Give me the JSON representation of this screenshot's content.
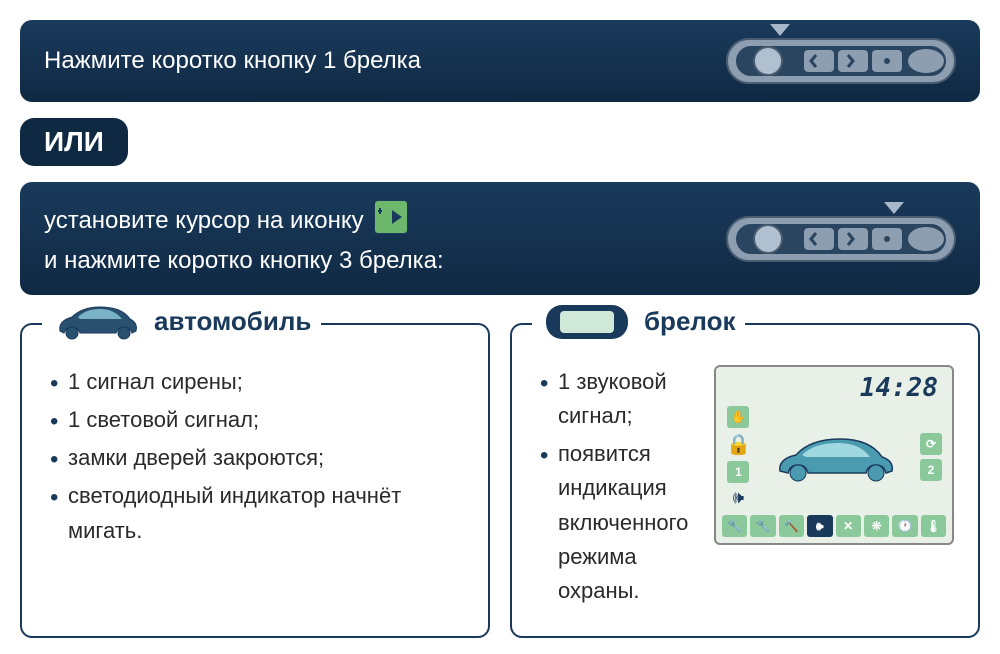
{
  "banner1": {
    "text": "Нажмите коротко кнопку 1 брелка"
  },
  "or_label": "ИЛИ",
  "banner2": {
    "text_a": "установите курсор  на  иконку",
    "text_b": "и нажмите коротко кнопку 3 брелка:"
  },
  "card_car": {
    "title": "автомобиль",
    "items": [
      "1 сигнал сирены;",
      "1 световой сигнал;",
      "замки дверей закроются;",
      "светодиодный индикатор начнёт мигать."
    ]
  },
  "card_fob": {
    "title": "брелок",
    "items": [
      "1 звуковой сигнал;",
      "появится индикация включенного режима охраны."
    ],
    "lcd_time": "14:28",
    "lcd_badge_left": "1",
    "lcd_badge_right": "2"
  }
}
